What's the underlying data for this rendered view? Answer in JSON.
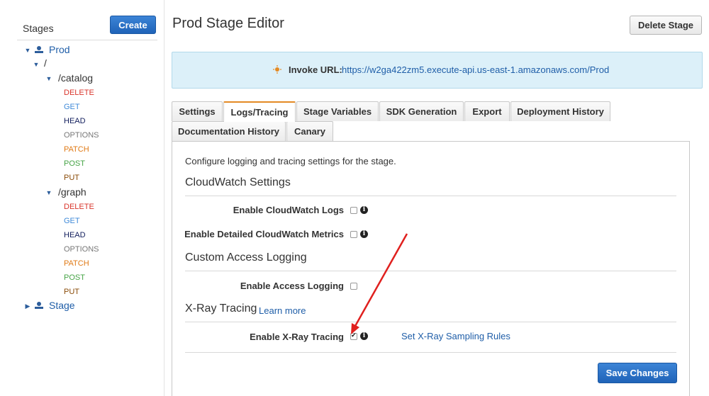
{
  "sidebar": {
    "title": "Stages",
    "create_label": "Create",
    "tree": {
      "prod_label": "Prod",
      "root_path": "/",
      "catalog_path": "/catalog",
      "catalog_methods": [
        "DELETE",
        "GET",
        "HEAD",
        "OPTIONS",
        "PATCH",
        "POST",
        "PUT"
      ],
      "graph_path": "/graph",
      "graph_methods": [
        "DELETE",
        "GET",
        "HEAD",
        "OPTIONS",
        "PATCH",
        "POST",
        "PUT"
      ],
      "stage_label": "Stage"
    }
  },
  "header": {
    "title": "Prod Stage Editor",
    "delete_label": "Delete Stage"
  },
  "invoke": {
    "label": "Invoke URL:",
    "url": "https://w2ga422zm5.execute-api.us-east-1.amazonaws.com/Prod"
  },
  "tabs": [
    {
      "label": "Settings",
      "active": false
    },
    {
      "label": "Logs/Tracing",
      "active": true
    },
    {
      "label": "Stage Variables",
      "active": false
    },
    {
      "label": "SDK Generation",
      "active": false
    },
    {
      "label": "Export",
      "active": false
    },
    {
      "label": "Deployment History",
      "active": false
    },
    {
      "label": "Documentation History",
      "active": false
    },
    {
      "label": "Canary",
      "active": false
    }
  ],
  "panel": {
    "description": "Configure logging and tracing settings for the stage.",
    "cloudwatch": {
      "title": "CloudWatch Settings",
      "logs_label": "Enable CloudWatch Logs",
      "logs_checked": false,
      "metrics_label": "Enable Detailed CloudWatch Metrics",
      "metrics_checked": false
    },
    "access_logging": {
      "title": "Custom Access Logging",
      "enable_label": "Enable Access Logging",
      "enable_checked": false
    },
    "xray": {
      "title": "X-Ray Tracing",
      "learn_more": "Learn more",
      "enable_label": "Enable X-Ray Tracing",
      "enable_checked": true,
      "sampling_link": "Set X-Ray Sampling Rules"
    },
    "save_label": "Save Changes"
  },
  "colors": {
    "primary_button": "#1f63b8",
    "link": "#1f5ea8",
    "active_tab_accent": "#e48a24",
    "info_banner": "#dcf0f9",
    "annotation_arrow": "#e0201e"
  }
}
